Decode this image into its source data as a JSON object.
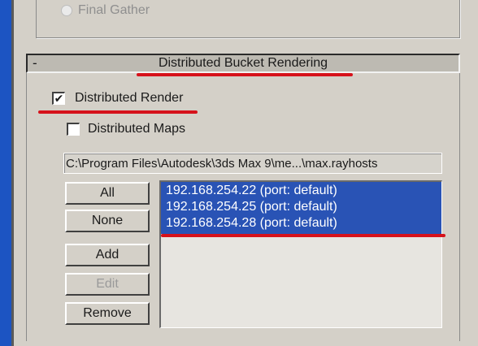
{
  "final_gather": {
    "label": "Final Gather"
  },
  "rollout": {
    "collapse_symbol": "-",
    "title": "Distributed Bucket Rendering"
  },
  "options": {
    "distributed_render": {
      "label": "Distributed Render",
      "checked": true,
      "mark": "✔"
    },
    "distributed_maps": {
      "label": "Distributed Maps",
      "checked": false
    }
  },
  "hosts_file": {
    "path": "C:\\Program Files\\Autodesk\\3ds Max 9\\me...\\max.rayhosts"
  },
  "buttons": {
    "all": "All",
    "none": "None",
    "add": "Add",
    "edit": "Edit",
    "remove": "Remove"
  },
  "hosts": [
    "192.168.254.22 (port: default)",
    "192.168.254.25 (port: default)",
    "192.168.254.28 (port: default)"
  ],
  "colors": {
    "selection": "#2953b5",
    "annotation_red": "#d6121b",
    "panel": "#d4d0c8"
  }
}
